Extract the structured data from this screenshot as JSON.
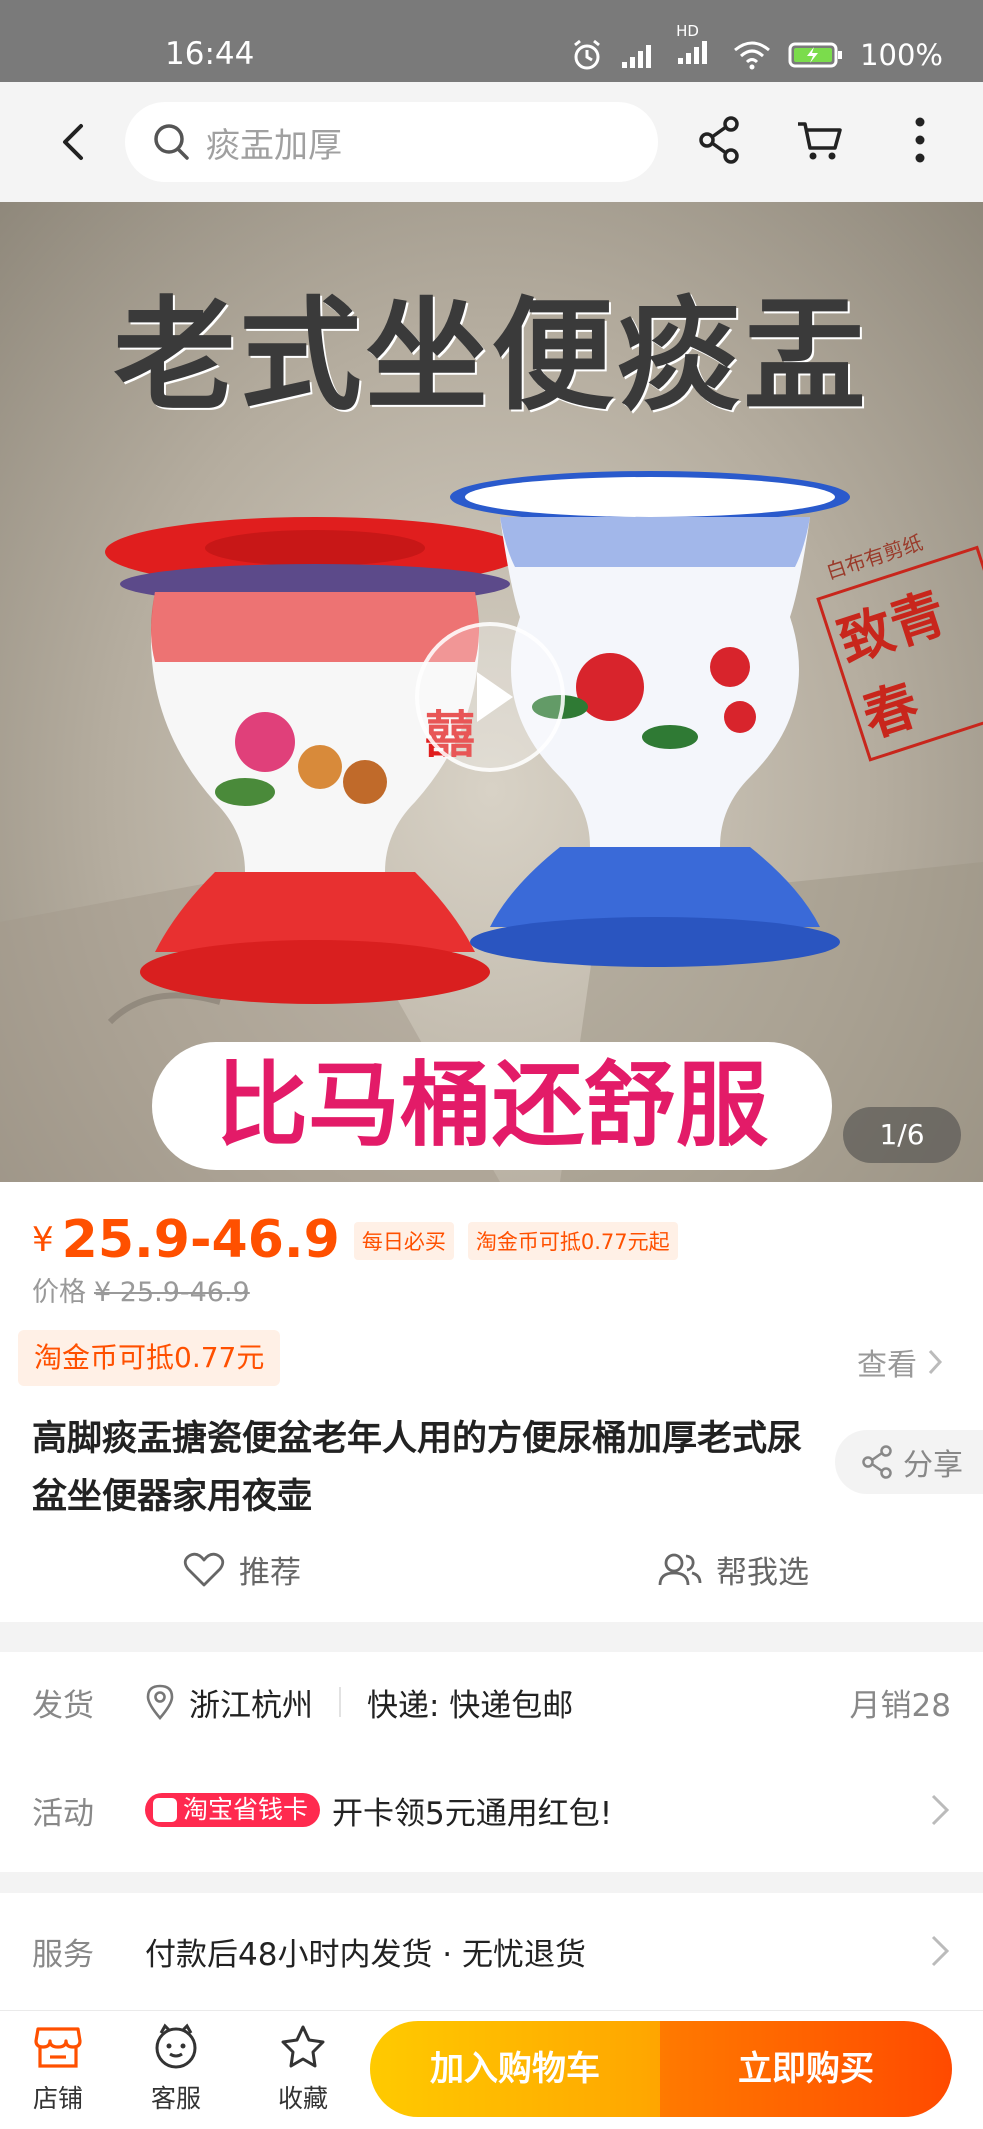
{
  "status_bar": {
    "time": "16:44",
    "network": "HD",
    "battery": "100%"
  },
  "nav": {
    "search_text": "痰盂加厚"
  },
  "hero": {
    "title": "老式坐便痰盂",
    "banner": "比马桶还舒服",
    "page_indicator": "1/6",
    "stamp_text": "致青春",
    "stamp_subtext": "白布有剪纸"
  },
  "price": {
    "currency": "¥",
    "value": "25.9-46.9",
    "tag_daily": "每日必买",
    "tag_coin": "淘金币可抵0.77元起",
    "orig_label": "价格",
    "orig_value": "¥ 25.9-46.9",
    "coin_badge": "淘金币可抵0.77元",
    "view_label": "查看"
  },
  "product": {
    "title": "高脚痰盂搪瓷便盆老年人用的方便尿桶加厚老式尿盆坐便器家用夜壶",
    "share_label": "分享",
    "recommend_label": "推荐",
    "help_choose_label": "帮我选"
  },
  "shipping": {
    "label": "发货",
    "location": "浙江杭州",
    "express": "快递: 快递包邮",
    "monthly_sales": "月销28"
  },
  "activity": {
    "label": "活动",
    "badge": "淘宝省钱卡",
    "text": "开卡领5元通用红包!"
  },
  "service": {
    "label": "服务",
    "text": "付款后48小时内发货 · 无忧退货"
  },
  "bottom": {
    "shop_label": "店铺",
    "service_label": "客服",
    "favorite_label": "收藏",
    "add_cart_label": "加入购物车",
    "buy_now_label": "立即购买"
  },
  "colors": {
    "accent": "#ff5000",
    "banner_text": "#e31b68",
    "cart_button": "#ffb000",
    "buy_button": "#ff5a00",
    "save_card": "#ff2a4f"
  }
}
